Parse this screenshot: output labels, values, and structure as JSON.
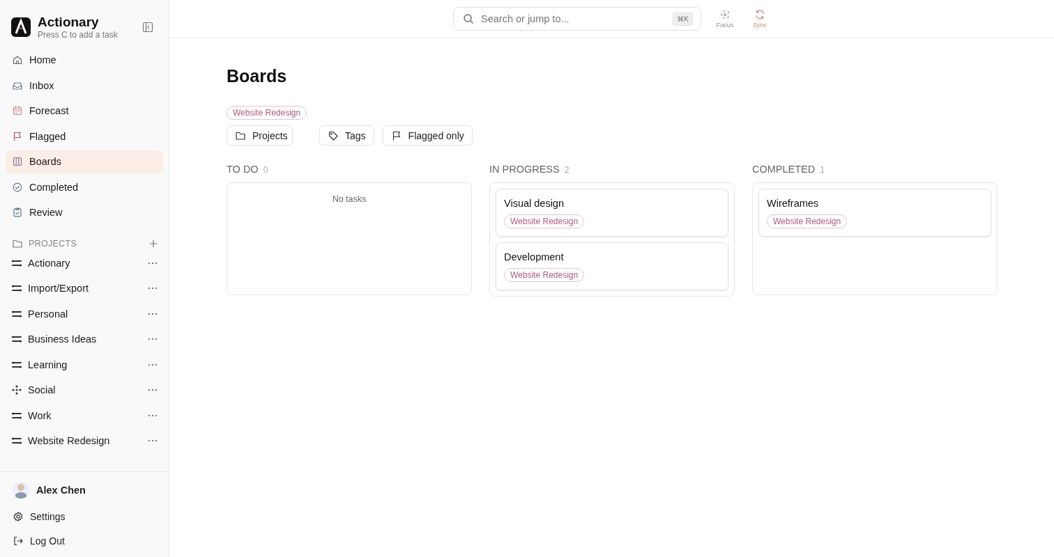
{
  "app": {
    "name": "Actionary",
    "hint": "Press C to add a task"
  },
  "nav": [
    {
      "label": "Home",
      "selected": false
    },
    {
      "label": "Inbox",
      "selected": false
    },
    {
      "label": "Forecast",
      "selected": false
    },
    {
      "label": "Flagged",
      "selected": false
    },
    {
      "label": "Boards",
      "selected": true
    },
    {
      "label": "Completed",
      "selected": false
    },
    {
      "label": "Review",
      "selected": false
    }
  ],
  "projects": {
    "title": "PROJECTS",
    "items": [
      {
        "label": "Actionary",
        "kind": "list"
      },
      {
        "label": "Import/Export",
        "kind": "list"
      },
      {
        "label": "Personal",
        "kind": "list"
      },
      {
        "label": "Business Ideas",
        "kind": "list"
      },
      {
        "label": "Learning",
        "kind": "list"
      },
      {
        "label": "Social",
        "kind": "dots"
      },
      {
        "label": "Work",
        "kind": "list"
      },
      {
        "label": "Website Redesign",
        "kind": "list"
      }
    ]
  },
  "user": {
    "name": "Alex Chen"
  },
  "footer": [
    "Settings",
    "Log Out"
  ],
  "topbar": {
    "search": {
      "placeholder": "Search or jump to...",
      "shortcut": "⌘K"
    },
    "actions": [
      {
        "label": "Focus",
        "disabled": true
      },
      {
        "label": "Sync",
        "disabled": false
      }
    ]
  },
  "page": {
    "title": "Boards",
    "active_filter": "Website Redesign",
    "filters": [
      "Projects",
      "Tags",
      "Flagged only"
    ]
  },
  "columns": [
    {
      "title": "TO DO",
      "count": "0",
      "empty_text": "No tasks"
    },
    {
      "title": "IN PROGRESS",
      "count": "2",
      "cards": [
        {
          "title": "Visual design",
          "tag": "Website Redesign"
        },
        {
          "title": "Development",
          "tag": "Website Redesign"
        }
      ]
    },
    {
      "title": "COMPLETED",
      "count": "1",
      "cards": [
        {
          "title": "Wireframes",
          "tag": "Website Redesign"
        }
      ]
    }
  ]
}
